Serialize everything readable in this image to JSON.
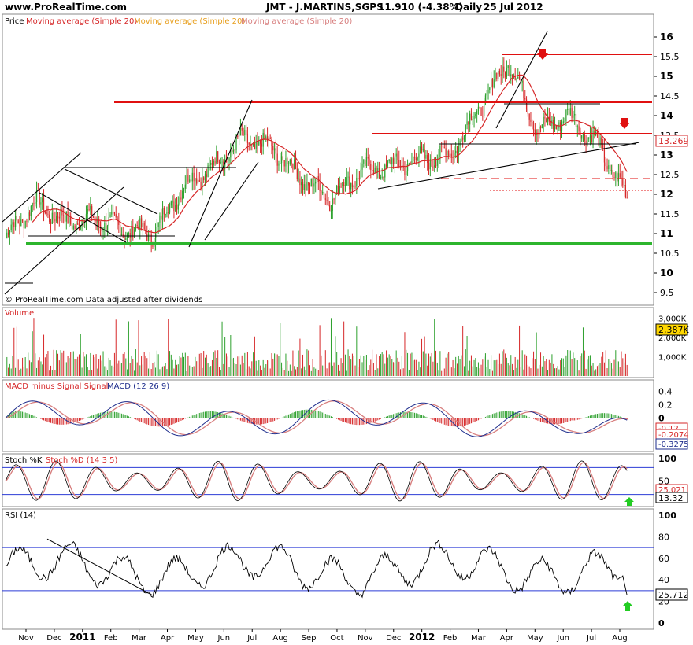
{
  "header": {
    "site": "www.ProRealTime.com",
    "instrument": "JMT - J.MARTINS,SGPS",
    "last": "11.910 (-4.38%)",
    "period": "Daily",
    "date": "25 Jul 2012"
  },
  "panels": {
    "price": {
      "title_prefix": "Price",
      "ma1": "Moving average (Simple 20)",
      "ma2": "Moving average (Simple 20)",
      "ma3": "Moving average (Simple 20)",
      "watermark": "© ProRealTime.com  Data adjusted after dividends",
      "last_label": "13.269"
    },
    "volume": {
      "title": "Volume",
      "last_label": "2,387K"
    },
    "macd": {
      "title_a": "MACD minus Signal Signal",
      "title_b": "MACD (12 26 9)",
      "labels": [
        "-0.12",
        "-0.2074",
        "-0.3275"
      ]
    },
    "stoch": {
      "title_a": "Stoch %K",
      "title_b": "Stoch %D (14 3 5)",
      "labels": [
        "13.32",
        "25.021"
      ]
    },
    "rsi": {
      "title": "RSI (14)",
      "last_label": "25.712"
    }
  },
  "x_axis": {
    "months": [
      "Nov",
      "Dec",
      "2011",
      "Feb",
      "Mar",
      "Apr",
      "May",
      "Jun",
      "Jul",
      "Aug",
      "Sep",
      "Oct",
      "Nov",
      "Dec",
      "2012",
      "Feb",
      "Mar",
      "Apr",
      "May",
      "Jun",
      "Jul",
      "Aug"
    ]
  },
  "colors": {
    "up": "#2ca02c",
    "down": "#d62728",
    "ma": "#d62728",
    "support": "#2db52d",
    "resistance": "#e01010",
    "panel_bg": "#ffffff",
    "grid_blue": "#2b3bd6",
    "label_blue": "#1e2d8c"
  },
  "chart_data": {
    "type": "line",
    "title": "JMT - J.MARTINS,SGPS",
    "price_axis": {
      "ticks": [
        9.5,
        10,
        10.5,
        11,
        11.5,
        12,
        12.5,
        13,
        13.5,
        14,
        14.5,
        15,
        15.5,
        16
      ],
      "ylim": [
        9.3,
        16.3
      ]
    },
    "price_close_monthly": [
      {
        "month": "Nov 2010",
        "close": 10.9
      },
      {
        "month": "Dec 2010",
        "close": 11.8
      },
      {
        "month": "Jan 2011",
        "close": 11.3
      },
      {
        "month": "Feb 2011",
        "close": 11.4
      },
      {
        "month": "Mar 2011",
        "close": 11.1
      },
      {
        "month": "Apr 2011",
        "close": 11.0
      },
      {
        "month": "May 2011",
        "close": 12.2
      },
      {
        "month": "Jun 2011",
        "close": 12.7
      },
      {
        "month": "Jul 2011",
        "close": 13.4
      },
      {
        "month": "Aug 2011",
        "close": 13.2
      },
      {
        "month": "Sep 2011",
        "close": 12.4
      },
      {
        "month": "Oct 2011",
        "close": 11.9
      },
      {
        "month": "Nov 2011",
        "close": 12.6
      },
      {
        "month": "Dec 2011",
        "close": 12.7
      },
      {
        "month": "Jan 2012",
        "close": 12.9
      },
      {
        "month": "Feb 2012",
        "close": 13.0
      },
      {
        "month": "Mar 2012",
        "close": 14.2
      },
      {
        "month": "Apr 2012",
        "close": 15.4
      },
      {
        "month": "May 2012",
        "close": 13.6
      },
      {
        "month": "Jun 2012",
        "close": 14.0
      },
      {
        "month": "Jul 2012",
        "close": 13.3
      },
      {
        "month": "Jul 25 2012",
        "close": 11.91
      }
    ],
    "horizontal_levels": [
      {
        "value": 15.55,
        "color": "red"
      },
      {
        "value": 14.35,
        "color": "red",
        "emphasis": true
      },
      {
        "value": 13.55,
        "color": "red"
      },
      {
        "value": 12.4,
        "color": "red",
        "style": "dashed"
      },
      {
        "value": 12.1,
        "color": "red",
        "style": "dotted"
      },
      {
        "value": 10.75,
        "color": "green",
        "emphasis": true
      }
    ],
    "volume_axis": {
      "ticks": [
        "1,000K",
        "2,000K",
        "3,000K"
      ]
    },
    "macd_axis": {
      "ticks": [
        0.4,
        0.2,
        0,
        -0.2,
        -0.4
      ]
    },
    "stoch_axis": {
      "ticks": [
        100,
        50
      ],
      "levels": [
        80,
        20
      ]
    },
    "rsi_axis": {
      "ticks": [
        100,
        80,
        60,
        40,
        20,
        0
      ],
      "levels": [
        70,
        50,
        30
      ]
    }
  }
}
